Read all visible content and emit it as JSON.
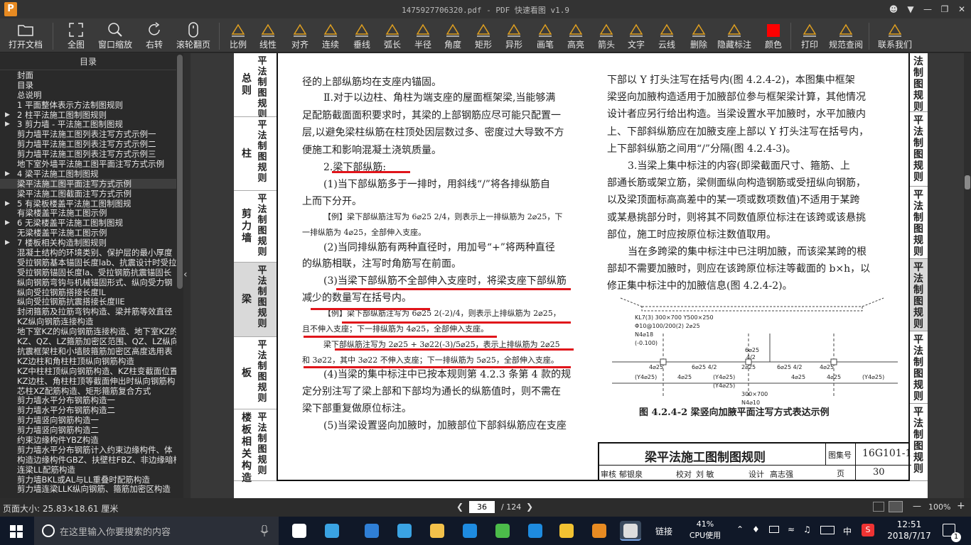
{
  "window": {
    "title": "1475927706320.pdf - PDF 快速看图 v1.9",
    "logo": "P"
  },
  "toolbar": [
    {
      "label": "打开文档",
      "icon": "folder-icon"
    },
    {
      "label": "全图",
      "icon": "fullscreen-icon"
    },
    {
      "label": "窗口缩放",
      "icon": "zoom-icon"
    },
    {
      "label": "右转",
      "icon": "rotate-icon"
    },
    {
      "label": "滚轮翻页",
      "icon": "mouse-icon"
    },
    {
      "label": "比例",
      "icon": "ruler-icon"
    },
    {
      "label": "线性",
      "icon": "linear-dim-icon"
    },
    {
      "label": "对齐",
      "icon": "align-dim-icon"
    },
    {
      "label": "连续",
      "icon": "continuous-dim-icon"
    },
    {
      "label": "垂线",
      "icon": "perpendicular-icon"
    },
    {
      "label": "弧长",
      "icon": "arc-length-icon"
    },
    {
      "label": "半径",
      "icon": "radius-icon"
    },
    {
      "label": "角度",
      "icon": "angle-icon"
    },
    {
      "label": "矩形",
      "icon": "rectangle-area-icon"
    },
    {
      "label": "异形",
      "icon": "polygon-area-icon"
    },
    {
      "label": "画笔",
      "icon": "pen-icon"
    },
    {
      "label": "高亮",
      "icon": "highlight-icon"
    },
    {
      "label": "箭头",
      "icon": "arrow-icon"
    },
    {
      "label": "文字",
      "icon": "text-icon"
    },
    {
      "label": "云线",
      "icon": "cloud-icon"
    },
    {
      "label": "删除",
      "icon": "eraser-icon"
    },
    {
      "label": "隐藏标注",
      "icon": "eye-hide-icon"
    },
    {
      "label": "颜色",
      "icon": "color-swatch-icon"
    },
    {
      "label": "打印",
      "icon": "printer-icon"
    },
    {
      "label": "规范查阅",
      "icon": "book-icon"
    },
    {
      "label": "联系我们",
      "icon": "support-icon"
    }
  ],
  "colors": {
    "annotation": "#e0141a",
    "swatch": "#ff0000"
  },
  "toc": {
    "header": "目录",
    "items": [
      {
        "label": "封面"
      },
      {
        "label": "目录"
      },
      {
        "label": "总说明"
      },
      {
        "label": "1 平面整体表示方法制图规则"
      },
      {
        "label": "2 柱平法施工图制图规则",
        "arrow": true
      },
      {
        "label": "3 剪力墙 - 平法施工图制图规",
        "arrow": true
      },
      {
        "label": "剪力墙平法施工图列表注写方式示例一"
      },
      {
        "label": "剪力墙平法施工图列表注写方式示例二"
      },
      {
        "label": "剪力墙平法施工图列表注写方式示例三"
      },
      {
        "label": "地下室外墙平法施工图平面注写方式示例"
      },
      {
        "label": "4 梁平法施工图制图规",
        "arrow": true
      },
      {
        "label": "梁平法施工图平面注写方式示例",
        "selected": true
      },
      {
        "label": "梁平法施工图截面注写方式示例"
      },
      {
        "label": "5 有梁板楼盖平法施工图制图规",
        "arrow": true
      },
      {
        "label": "有梁楼盖平法施工图示例"
      },
      {
        "label": "6 无梁楼盖平法施工图制图规",
        "arrow": true
      },
      {
        "label": "无梁楼盖平法施工图示例"
      },
      {
        "label": "7 楼板相关构造制图规则",
        "arrow": true
      },
      {
        "label": "混凝土结构的环境类别、保护层的最小厚度"
      },
      {
        "label": "受拉钢筋基本锚固长度lab、抗震设计时受拉"
      },
      {
        "label": "受拉钢筋锚固长度la、受拉钢筋抗震锚固长"
      },
      {
        "label": "纵向钢筋弯钩与机械锚固形式、纵向受力钢"
      },
      {
        "label": "纵向受拉钢筋搭接长度lL"
      },
      {
        "label": "纵向受拉钢筋抗震搭接长度llE"
      },
      {
        "label": "封闭箍筋及拉筋弯钩构造、梁并筋等效直径"
      },
      {
        "label": "KZ纵向钢筋连接构造"
      },
      {
        "label": "地下室KZ的纵向钢筋连接构造、地下室KZ的"
      },
      {
        "label": "KZ、QZ、LZ箍筋加密区范围、QZ、LZ纵向钢"
      },
      {
        "label": "抗震框架柱和小墙肢箍筋加密区高度选用表"
      },
      {
        "label": "KZ边柱和角柱柱顶纵向钢筋构造"
      },
      {
        "label": "KZ中柱柱顶纵向钢筋构造、KZ柱变截面位置"
      },
      {
        "label": "KZ边柱、角柱柱顶等截面伸出时纵向钢筋构"
      },
      {
        "label": "芯柱XZ配筋构造、矩形箍筋复合方式"
      },
      {
        "label": "剪力墙水平分布钢筋构造一"
      },
      {
        "label": "剪力墙水平分布钢筋构造二"
      },
      {
        "label": "剪力墙竖向钢筋构造一"
      },
      {
        "label": "剪力墙竖向钢筋构造二"
      },
      {
        "label": "约束边缘构件YBZ构造"
      },
      {
        "label": "剪力墙水平分布钢筋计入约束边缘构件、体"
      },
      {
        "label": "构造边缘构件GBZ、扶壁柱FBZ、非边缘暗柱"
      },
      {
        "label": "连梁LL配筋构造"
      },
      {
        "label": "剪力墙BKL或AL与LL重叠时配筋构造"
      },
      {
        "label": "剪力墙连梁LLK纵向钢筋、箍筋加密区构造"
      }
    ]
  },
  "page_left_tabs": [
    {
      "t1": "总则",
      "t2": "平法制图规则"
    },
    {
      "t1": "柱",
      "t2": "平法制图规则"
    },
    {
      "t1": "剪力墙",
      "t2": "平法制图规则"
    },
    {
      "t1": "梁",
      "t2": "平法制图规则",
      "active": true
    },
    {
      "t1": "板",
      "t2": "平法制图规则"
    },
    {
      "t1": "楼板相关构造",
      "t2": "平法制图规则"
    }
  ],
  "page_right_tabs": [
    {
      "t": "法制图规则"
    },
    {
      "t": "平法制图规则"
    },
    {
      "t": "平法制图规则"
    },
    {
      "t": "平法制图规则",
      "active": true
    },
    {
      "t": "平法制图规则"
    },
    {
      "t": "平法制图规则"
    }
  ],
  "doc": {
    "left_col": [
      {
        "text": "径的上部纵筋均在支座内锚固。",
        "cls": "p1"
      },
      {
        "text": "Ⅱ.对于以边柱、角柱为端支座的屋面框架梁,当能够满",
        "cls": "p1",
        "indent": true
      },
      {
        "text": "足配筋截面面积要求时，其梁的上部钢筋应尽可能只配置一",
        "cls": "p1"
      },
      {
        "text": "层,以避免梁柱纵筋在柱顶处因层数过多、密度过大导致不方",
        "cls": "p1"
      },
      {
        "text": "便施工和影响混凝土浇筑质量。",
        "cls": "p1"
      },
      {
        "text": "2.梁下部纵筋:",
        "cls": "p1",
        "indent": true
      },
      {
        "text": "(1)当下部纵筋多于一排时，用斜线“/”将各排纵筋自",
        "cls": "p1",
        "indent": true
      },
      {
        "text": "上而下分开。",
        "cls": "p1"
      },
      {
        "text": "【例】梁下部纵筋注写为 6⌀25 2/4，则表示上一排纵筋为 2⌀25，下",
        "cls": "p2",
        "indent": true
      },
      {
        "text": "一排纵筋为 4⌀25，全部伸入支座。",
        "cls": "p2"
      },
      {
        "text": "(2)当同排纵筋有两种直径时，用加号“+”将两种直径",
        "cls": "p1",
        "indent": true
      },
      {
        "text": "的纵筋相联，注写时角筋写在前面。",
        "cls": "p1"
      },
      {
        "text": "(3)当梁下部纵筋不全部伸入支座时，将梁支座下部纵筋",
        "cls": "p1",
        "indent": true
      },
      {
        "text": "减少的数量写在括号内。",
        "cls": "p1"
      },
      {
        "text": "【例】梁下部纵筋注写为 6⌀25 2(-2)/4，则表示上排纵筋为 2⌀25，",
        "cls": "p2",
        "indent": true
      },
      {
        "text": "且不伸入支座；下一排纵筋为 4⌀25，全部伸入支座。",
        "cls": "p2"
      },
      {
        "text": "梁下部纵筋注写为 2⌀25 + 3⌀22(-3)/5⌀25，表示上排纵筋为 2⌀25",
        "cls": "p2",
        "indent": true
      },
      {
        "text": "和 3⌀22，其中 3⌀22 不伸入支座；下一排纵筋为 5⌀25，全部伸入支座。",
        "cls": "p2"
      },
      {
        "text": "(4)当梁的集中标注中已按本规则第 4.2.3 条第 4 款的规",
        "cls": "p1",
        "indent": true
      },
      {
        "text": "定分别注写了梁上部和下部均为通长的纵筋值时，则不需在",
        "cls": "p1"
      },
      {
        "text": "梁下部重复做原位标注。",
        "cls": "p1"
      },
      {
        "text": "(5)当梁设置竖向加腋时，加腋部位下部斜纵筋应在支座",
        "cls": "p1",
        "indent": true
      }
    ],
    "right_col": [
      {
        "text": "下部以 Y 打头注写在括号内(图 4.2.4-2)，本图集中框架"
      },
      {
        "text": "梁竖向加腋构造适用于加腋部位参与框架梁计算，其他情况"
      },
      {
        "text": "设计者应另行给出构造。当梁设置水平加腋时，水平加腋内"
      },
      {
        "text": "上、下部斜纵筋应在加腋支座上部以 Y 打头注写在括号内，"
      },
      {
        "text": "上下部斜纵筋之间用“/”分隔(图 4.2.4-3)。"
      },
      {
        "text": "3.当梁上集中标注的内容(即梁截面尺寸、箍筋、上",
        "indent": true
      },
      {
        "text": "部通长筋或架立筋，梁侧面纵向构造钢筋或受扭纵向钢筋，"
      },
      {
        "text": "以及梁顶面标高高差中的某一项或数项数值)不适用于某跨"
      },
      {
        "text": "或某悬挑部分时，则将其不同数值原位标注在该跨或该悬挑"
      },
      {
        "text": "部位，施工时应按原位标注数值取用。"
      },
      {
        "text": "当在多跨梁的集中标注中已注明加腋，而该梁某跨的根",
        "indent": true
      },
      {
        "text": "部却不需要加腋时，则应在该跨原位标注等截面的 b×h，以"
      },
      {
        "text": "修正集中标注中的加腋信息(图 4.2.4-2)。"
      }
    ],
    "figure": {
      "labels": [
        "KL7(3) 300×700 Y500×250",
        "Φ10@100/200(2) 2⌀25",
        "N4⌀18",
        "(-0.100)",
        "6⌀25",
        "4/2",
        "4⌀25",
        "6⌀25 4/2",
        "2⌀25",
        "6⌀25 4/2",
        "4⌀25",
        "(Y4⌀25)",
        "4⌀25",
        "(Y4⌀25)",
        "300×700",
        "N4⌀10",
        "(Y4⌀25)",
        "4⌀25",
        "4⌀25",
        "(Y4⌀25)"
      ],
      "caption": "图 4.2.4-2 梁竖向加腋平面注写方式表达示例"
    },
    "title_block": {
      "title": "梁平法施工图制图规则",
      "atlas_label": "图集号",
      "atlas_no": "16G101-1",
      "row": [
        "审核",
        "郁银泉",
        "校对",
        "刘 敏",
        "设计",
        "高志强"
      ],
      "page_label": "页",
      "page_no": "30"
    }
  },
  "status": {
    "page_size": "页面大小: 25.83×18.61 厘米",
    "current_page": "36",
    "total_pages": "/ 124",
    "zoom": "100%"
  },
  "taskbar": {
    "search_placeholder": "在这里输入你要搜索的内容",
    "link_label": "链接",
    "cpu_percent": "41%",
    "cpu_label": "CPU使用",
    "lang": "中",
    "time": "12:51",
    "date": "2018/7/17",
    "notifications": "1"
  }
}
